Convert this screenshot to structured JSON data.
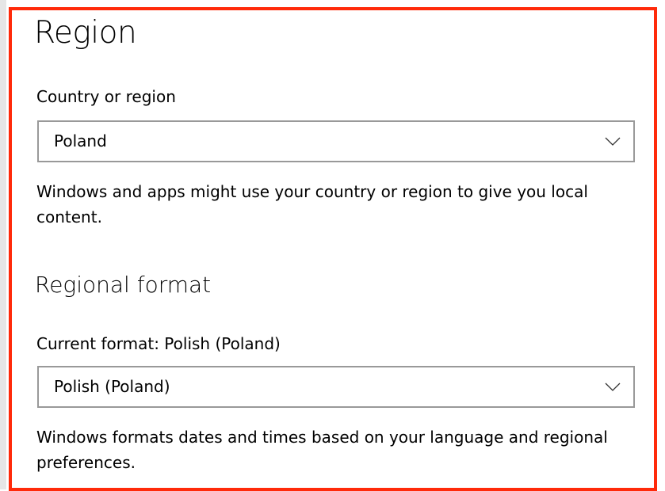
{
  "region": {
    "title": "Region",
    "country_label": "Country or region",
    "country_value": "Poland",
    "country_description": "Windows and apps might use your country or region to give you local content."
  },
  "regional_format": {
    "title": "Regional format",
    "current_format_label": "Current format: Polish (Poland)",
    "format_value": "Polish (Poland)",
    "format_description": "Windows formats dates and times based on your language and regional preferences."
  },
  "icons": {
    "dropdown": "chevron-down-icon"
  },
  "colors": {
    "highlight_frame": "#ff2a0a",
    "combo_border": "#999999"
  }
}
